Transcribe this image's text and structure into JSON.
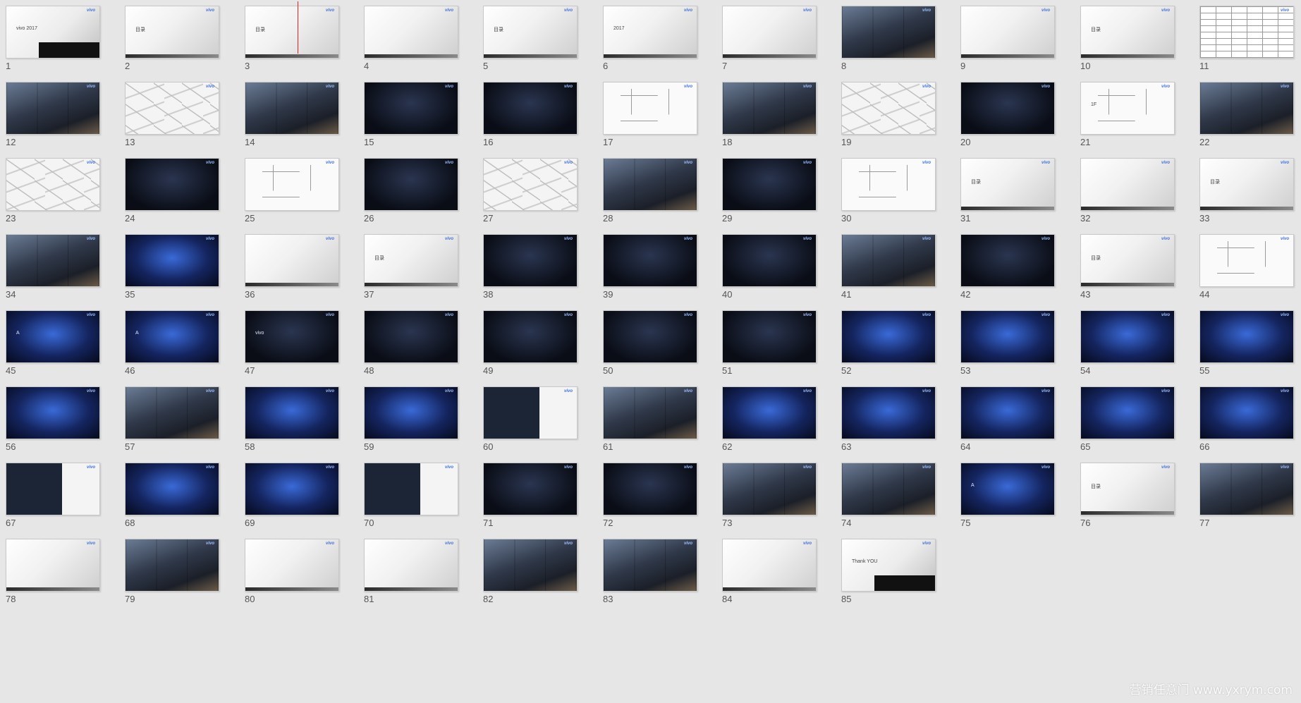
{
  "slides": [
    {
      "n": "1",
      "style": "white-end",
      "mark": "vivo 2017"
    },
    {
      "n": "2",
      "style": "light",
      "mark": "目录"
    },
    {
      "n": "3",
      "style": "light",
      "mark": "目录"
    },
    {
      "n": "4",
      "style": "light",
      "mark": ""
    },
    {
      "n": "5",
      "style": "light",
      "mark": "目录"
    },
    {
      "n": "6",
      "style": "light",
      "mark": "2017"
    },
    {
      "n": "7",
      "style": "light",
      "mark": ""
    },
    {
      "n": "8",
      "style": "photo",
      "mark": ""
    },
    {
      "n": "9",
      "style": "light",
      "mark": ""
    },
    {
      "n": "10",
      "style": "light",
      "mark": "目录"
    },
    {
      "n": "11",
      "style": "table",
      "mark": ""
    },
    {
      "n": "12",
      "style": "photo",
      "mark": ""
    },
    {
      "n": "13",
      "style": "map",
      "mark": ""
    },
    {
      "n": "14",
      "style": "photo",
      "mark": ""
    },
    {
      "n": "15",
      "style": "dark",
      "mark": ""
    },
    {
      "n": "16",
      "style": "dark",
      "mark": ""
    },
    {
      "n": "17",
      "style": "plan",
      "mark": ""
    },
    {
      "n": "18",
      "style": "photo",
      "mark": ""
    },
    {
      "n": "19",
      "style": "map",
      "mark": ""
    },
    {
      "n": "20",
      "style": "dark",
      "mark": ""
    },
    {
      "n": "21",
      "style": "plan",
      "mark": "1F"
    },
    {
      "n": "22",
      "style": "photo",
      "mark": ""
    },
    {
      "n": "23",
      "style": "map",
      "mark": ""
    },
    {
      "n": "24",
      "style": "dark",
      "mark": ""
    },
    {
      "n": "25",
      "style": "plan",
      "mark": ""
    },
    {
      "n": "26",
      "style": "dark",
      "mark": ""
    },
    {
      "n": "27",
      "style": "map",
      "mark": ""
    },
    {
      "n": "28",
      "style": "photo",
      "mark": ""
    },
    {
      "n": "29",
      "style": "dark",
      "mark": ""
    },
    {
      "n": "30",
      "style": "plan",
      "mark": ""
    },
    {
      "n": "31",
      "style": "light",
      "mark": "目录"
    },
    {
      "n": "32",
      "style": "light",
      "mark": ""
    },
    {
      "n": "33",
      "style": "light",
      "mark": "目录"
    },
    {
      "n": "34",
      "style": "photo",
      "mark": ""
    },
    {
      "n": "35",
      "style": "blue",
      "mark": ""
    },
    {
      "n": "36",
      "style": "light",
      "mark": ""
    },
    {
      "n": "37",
      "style": "light",
      "mark": "目录"
    },
    {
      "n": "38",
      "style": "dark",
      "mark": ""
    },
    {
      "n": "39",
      "style": "dark",
      "mark": ""
    },
    {
      "n": "40",
      "style": "dark",
      "mark": ""
    },
    {
      "n": "41",
      "style": "photo",
      "mark": ""
    },
    {
      "n": "42",
      "style": "dark",
      "mark": ""
    },
    {
      "n": "43",
      "style": "light",
      "mark": "目录"
    },
    {
      "n": "44",
      "style": "plan",
      "mark": ""
    },
    {
      "n": "45",
      "style": "blue",
      "mark": "A"
    },
    {
      "n": "46",
      "style": "blue",
      "mark": "A"
    },
    {
      "n": "47",
      "style": "dark",
      "mark": "vivo"
    },
    {
      "n": "48",
      "style": "dark",
      "mark": ""
    },
    {
      "n": "49",
      "style": "dark",
      "mark": ""
    },
    {
      "n": "50",
      "style": "dark",
      "mark": ""
    },
    {
      "n": "51",
      "style": "dark",
      "mark": ""
    },
    {
      "n": "52",
      "style": "blue",
      "mark": ""
    },
    {
      "n": "53",
      "style": "blue",
      "mark": ""
    },
    {
      "n": "54",
      "style": "blue",
      "mark": ""
    },
    {
      "n": "55",
      "style": "blue",
      "mark": ""
    },
    {
      "n": "56",
      "style": "blue",
      "mark": ""
    },
    {
      "n": "57",
      "style": "photo",
      "mark": ""
    },
    {
      "n": "58",
      "style": "blue",
      "mark": ""
    },
    {
      "n": "59",
      "style": "blue",
      "mark": ""
    },
    {
      "n": "60",
      "style": "split",
      "mark": ""
    },
    {
      "n": "61",
      "style": "photo",
      "mark": ""
    },
    {
      "n": "62",
      "style": "blue",
      "mark": ""
    },
    {
      "n": "63",
      "style": "blue",
      "mark": ""
    },
    {
      "n": "64",
      "style": "blue",
      "mark": ""
    },
    {
      "n": "65",
      "style": "blue",
      "mark": ""
    },
    {
      "n": "66",
      "style": "blue",
      "mark": ""
    },
    {
      "n": "67",
      "style": "split",
      "mark": ""
    },
    {
      "n": "68",
      "style": "blue",
      "mark": ""
    },
    {
      "n": "69",
      "style": "blue",
      "mark": ""
    },
    {
      "n": "70",
      "style": "split",
      "mark": ""
    },
    {
      "n": "71",
      "style": "dark",
      "mark": ""
    },
    {
      "n": "72",
      "style": "dark",
      "mark": ""
    },
    {
      "n": "73",
      "style": "photo",
      "mark": ""
    },
    {
      "n": "74",
      "style": "photo",
      "mark": ""
    },
    {
      "n": "75",
      "style": "blue",
      "mark": "A"
    },
    {
      "n": "76",
      "style": "light",
      "mark": "目录"
    },
    {
      "n": "77",
      "style": "photo",
      "mark": ""
    },
    {
      "n": "78",
      "style": "light",
      "mark": ""
    },
    {
      "n": "79",
      "style": "photo",
      "mark": ""
    },
    {
      "n": "80",
      "style": "light",
      "mark": ""
    },
    {
      "n": "81",
      "style": "light",
      "mark": ""
    },
    {
      "n": "82",
      "style": "photo",
      "mark": ""
    },
    {
      "n": "83",
      "style": "photo",
      "mark": ""
    },
    {
      "n": "84",
      "style": "light",
      "mark": ""
    },
    {
      "n": "85",
      "style": "white-end",
      "mark": "Thank YOU"
    }
  ],
  "brand_text": "vivo",
  "watermark": "营销任意门 www.yxrym.com",
  "colors": {
    "background": "#e6e6e6",
    "brand_blue": "#3d6fd6",
    "selection_line": "#dd2222"
  }
}
